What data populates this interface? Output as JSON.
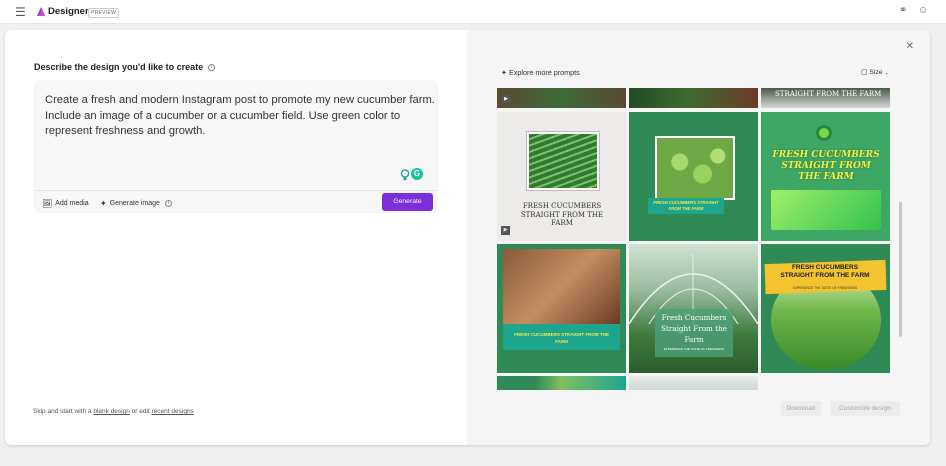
{
  "app": {
    "name": "Designer",
    "badge": "PREVIEW"
  },
  "left": {
    "heading": "Describe the design you'd like to create",
    "prompt_text": "Create a fresh and modern Instagram post to promote my new cucumber farm. Include an image of a cucumber or a cucumber field. Use green color to represent freshness and growth.",
    "add_media_label": "Add media",
    "generate_image_label": "Generate image",
    "generate_label": "Generate",
    "footer": {
      "prefix": "Skip and start with a ",
      "blank_design_link": "blank design",
      "middle": " or edit ",
      "recent_designs_link": "recent designs"
    }
  },
  "right": {
    "explore_label": "Explore more prompts",
    "size_label": "Size",
    "download_label": "Download",
    "customize_label": "Customize design",
    "tiles": {
      "t0": "STRAIGHT FROM THE FARM",
      "t1_title": "FRESH CUCUMBERS STRAIGHT FROM THE FARM",
      "t2_title": "FRESH CUCUMBERS STRAIGHT FROM THE FARM",
      "t2_caption": "FRESH CUCUMBERS STRAIGHT FROM THE FARM",
      "t3_title": "FRESH CUCUMBERS STRAIGHT FROM THE FARM",
      "t4_caption": "FRESH CUCUMBERS STRAIGHT FROM THE FARM",
      "t5_title": "Fresh Cucumbers Straight From the Farm",
      "t5_sub": "EXPERIENCE THE TASTE OF FRESHNESS",
      "t6_title": "FRESH CUCUMBERS STRAIGHT FROM THE FARM",
      "t6_sub": "EXPERIENCE THE TASTE OF FRESHNESS"
    }
  },
  "colors": {
    "accent": "#7c2fd8",
    "tile_green": "#2f8a55",
    "teal": "#1ea58e",
    "yellow": "#f4c430"
  }
}
